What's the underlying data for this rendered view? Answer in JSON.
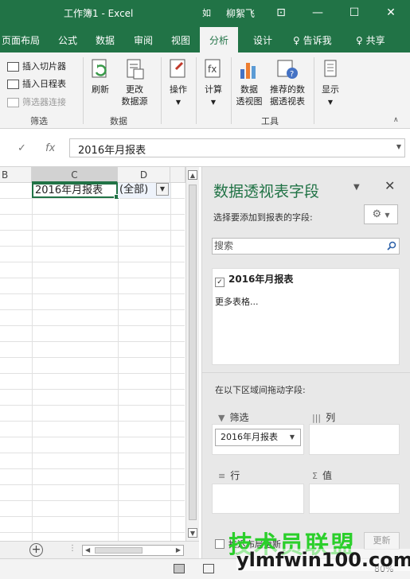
{
  "window": {
    "title": "工作簿1  -  Excel",
    "user_avatar": "如",
    "user_name": "柳絮飞",
    "controls": [
      "⊡",
      "—",
      "☐",
      "✕"
    ]
  },
  "tabs": {
    "items": [
      "页面布局",
      "公式",
      "数据",
      "审阅",
      "视图",
      "分析",
      "设计"
    ],
    "active": "分析",
    "search": "♀ 告诉我",
    "share": "♀ 共享"
  },
  "ribbon": {
    "filter_group": {
      "insert_slicer": "插入切片器",
      "insert_timeline": "插入日程表",
      "filter_connections": "筛选器连接",
      "label": "筛选"
    },
    "data_group": {
      "refresh": "刷新",
      "change_source_1": "更改",
      "change_source_2": "数据源",
      "label": "数据"
    },
    "actions": "操作",
    "calculations": "计算",
    "tools_group": {
      "pivot_chart_1": "数据",
      "pivot_chart_2": "透视图",
      "recommended_1": "推荐的数",
      "recommended_2": "据透视表",
      "label": "工具"
    },
    "show": "显示"
  },
  "formula_bar": {
    "cancel": "✓",
    "fx": "fx",
    "value": "2016年月报表"
  },
  "sheet": {
    "columns": [
      "B",
      "C",
      "D"
    ],
    "selected_column": "C",
    "cell_c1": "2016年月报表",
    "cell_d1": "(全部)"
  },
  "pivot_pane": {
    "title": "数据透视表字段",
    "subtitle": "选择要添加到报表的字段:",
    "search_placeholder": "搜索",
    "fields": [
      {
        "name": "2016年月报表",
        "checked": true
      }
    ],
    "more_tables": "更多表格...",
    "drag_label": "在以下区域间拖动字段:",
    "areas": {
      "filter": "筛选",
      "columns": "列",
      "rows": "行",
      "values": "值"
    },
    "filter_chip": "2016年月报表",
    "defer_label": "推迟布局更新",
    "update_button": "更新"
  },
  "status": {
    "zoom": "80%"
  },
  "watermark": {
    "line1": "技术员联盟",
    "line2": "ylmfwin100.com"
  }
}
